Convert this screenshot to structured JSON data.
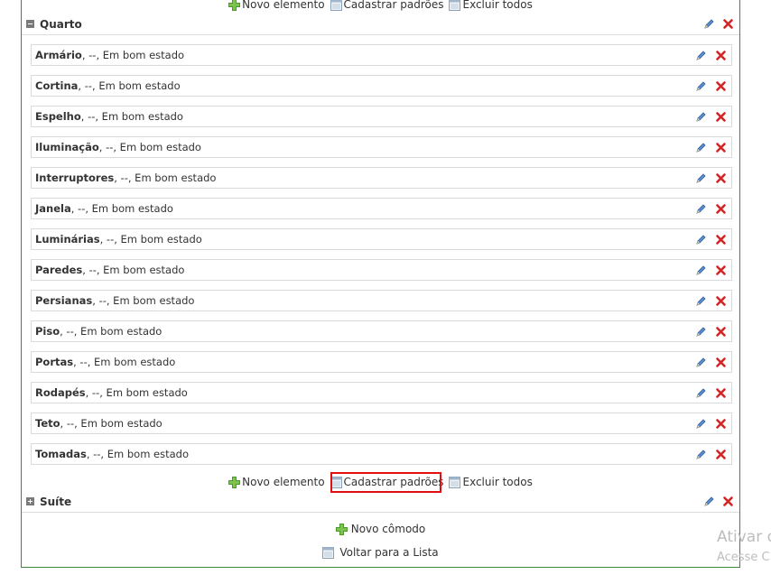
{
  "top_actions": {
    "new_element": "Novo elemento",
    "register_defaults": "Cadastrar padrões",
    "delete_all": "Excluir todos"
  },
  "rooms": [
    {
      "title": "Quarto",
      "expanded": true,
      "items": [
        {
          "name": "Armário",
          "detail": ", --, Em bom estado"
        },
        {
          "name": "Cortina",
          "detail": ", --, Em bom estado"
        },
        {
          "name": "Espelho",
          "detail": ", --, Em bom estado"
        },
        {
          "name": "Iluminação",
          "detail": ", --, Em bom estado"
        },
        {
          "name": "Interruptores",
          "detail": ", --, Em bom estado"
        },
        {
          "name": "Janela",
          "detail": ", --, Em bom estado"
        },
        {
          "name": "Luminárias",
          "detail": ", --, Em bom estado"
        },
        {
          "name": "Paredes",
          "detail": ", --, Em bom estado"
        },
        {
          "name": "Persianas",
          "detail": ", --, Em bom estado"
        },
        {
          "name": "Piso",
          "detail": ", --, Em bom estado"
        },
        {
          "name": "Portas",
          "detail": ", --, Em bom estado"
        },
        {
          "name": "Rodapés",
          "detail": ", --, Em bom estado"
        },
        {
          "name": "Teto",
          "detail": ", --, Em bom estado"
        },
        {
          "name": "Tomadas",
          "detail": ", --, Em bom estado"
        }
      ],
      "actions": {
        "new_element": "Novo elemento",
        "register_defaults": "Cadastrar padrões",
        "delete_all": "Excluir todos"
      }
    },
    {
      "title": "Suíte",
      "expanded": false
    }
  ],
  "footer": {
    "new_room": "Novo cômodo",
    "back_to_list": "Voltar para a Lista"
  },
  "watermark": {
    "line1": "Ativar o",
    "line2": "Acesse C"
  },
  "colors": {
    "accent_green": "#3a8a3a",
    "highlight_red": "#e01010",
    "delete_red": "#d42424",
    "edit_blue": "#3b6fb0"
  },
  "icons": {
    "add": "green-plus-icon",
    "register": "calendar-icon",
    "delete_all": "calendar-icon",
    "edit": "pencil-icon",
    "delete": "red-x-icon",
    "collapse": "minus-square-icon",
    "expand": "plus-square-icon"
  }
}
